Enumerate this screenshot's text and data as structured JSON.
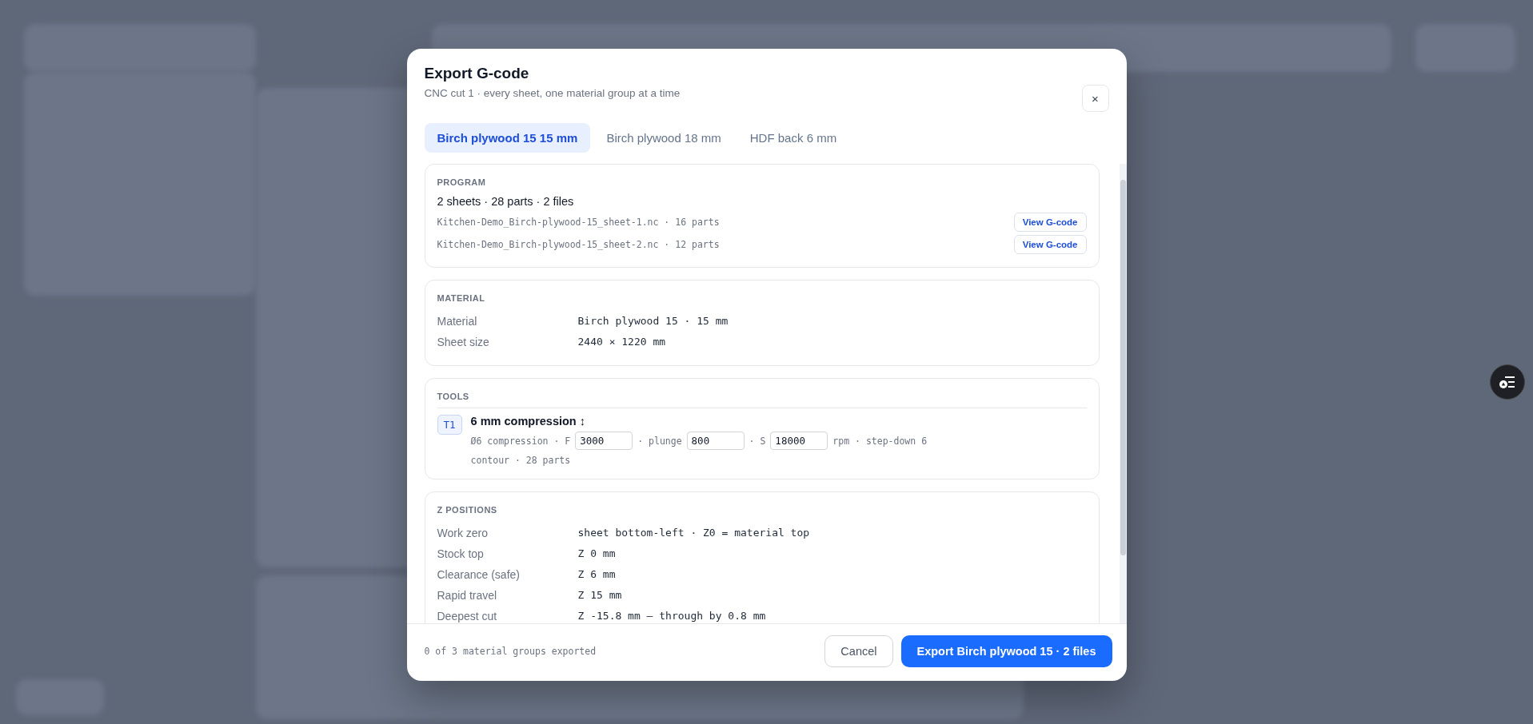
{
  "dialog": {
    "title": "Export G-code",
    "subtitle": "CNC cut 1 · every sheet, one material group at a time",
    "close_label": "×",
    "tabs": [
      {
        "label": "Birch plywood 15 15 mm",
        "selected": true
      },
      {
        "label": "Birch plywood 18 mm",
        "selected": false
      },
      {
        "label": "HDF back 6 mm",
        "selected": false
      }
    ],
    "sections": [
      {
        "kind": "program",
        "heading": "PROGRAM",
        "summary": "2 sheets · 28 parts · 2 files",
        "files": [
          {
            "name": "Kitchen-Demo_Birch-plywood-15_sheet-1.nc · 16 parts",
            "button": "View G-code"
          },
          {
            "name": "Kitchen-Demo_Birch-plywood-15_sheet-2.nc · 12 parts",
            "button": "View G-code"
          }
        ]
      },
      {
        "kind": "fields",
        "heading": "MATERIAL",
        "rows": [
          {
            "label": "Material",
            "value": "Birch plywood 15 · 15 mm"
          },
          {
            "label": "Sheet size",
            "value": "2440 × 1220 mm"
          }
        ]
      },
      {
        "kind": "tools",
        "heading": "TOOLS",
        "tools": [
          {
            "badge": "T1",
            "name": "6 mm compression ↕",
            "params": [
              {
                "kind": "text",
                "text": "Ø6 compression · F"
              },
              {
                "kind": "input",
                "value": "3000"
              },
              {
                "kind": "text",
                "text": "· plunge"
              },
              {
                "kind": "input",
                "value": "800"
              },
              {
                "kind": "text",
                "text": "· S"
              },
              {
                "kind": "input",
                "value": "18000"
              },
              {
                "kind": "text",
                "text": "rpm · step-down 6"
              }
            ],
            "detail": "contour · 28 parts"
          }
        ]
      },
      {
        "kind": "fields",
        "heading": "Z POSITIONS",
        "rows": [
          {
            "label": "Work zero",
            "value": "sheet bottom-left · Z0 = material top"
          },
          {
            "label": "Stock top",
            "value": "Z 0 mm"
          },
          {
            "label": "Clearance (safe)",
            "value": "Z 6 mm"
          },
          {
            "label": "Rapid travel",
            "value": "Z 15 mm"
          },
          {
            "label": "Deepest cut",
            "value": "Z -15.8 mm — through by 0.8 mm"
          }
        ]
      }
    ],
    "footer": {
      "status": "0 of 3 material groups exported",
      "cancel": "Cancel",
      "export": "Export Birch plywood 15 · 2 files"
    }
  }
}
